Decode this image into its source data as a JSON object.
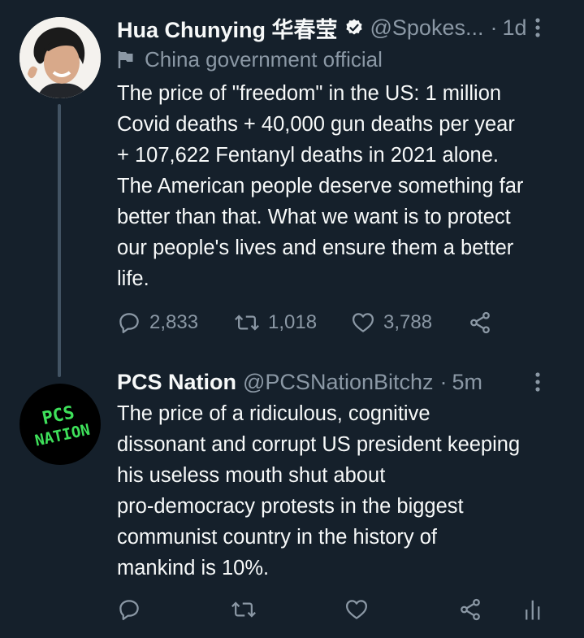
{
  "tweets": [
    {
      "name": "Hua Chunying 华春莹",
      "handle": "@Spokes...",
      "time": "1d",
      "label": "China government official",
      "text": "The price of \"freedom\" in the US: 1 million\nCovid deaths + 40,000 gun deaths per year\n+ 107,622 Fentanyl deaths in 2021 alone.\nThe American people deserve something far\nbetter than that. What we want is to protect\nour people's lives and ensure them a better\nlife.",
      "replies": "2,833",
      "retweets": "1,018",
      "likes": "3,788"
    },
    {
      "name": "PCS Nation",
      "handle": "@PCSNationBitchz",
      "time": "5m",
      "avatar_text_1": "PCS",
      "avatar_text_2": "NATION",
      "text": "The price of a ridiculous, cognitive\ndissonant and corrupt US president keeping\nhis useless mouth shut about\npro-democracy protests in the biggest\ncommunist country in the history of\nmankind is 10%."
    }
  ],
  "colors": {
    "background": "#15202b",
    "text": "#f7f9f9",
    "muted": "#8b98a5",
    "verified": "#f7f9f9",
    "thread_line": "#425363",
    "avatar_green": "#3ee05a"
  },
  "icons": [
    "verified-badge-icon",
    "more-icon",
    "flag-icon",
    "reply-icon",
    "retweet-icon",
    "like-icon",
    "share-icon",
    "analytics-icon"
  ]
}
